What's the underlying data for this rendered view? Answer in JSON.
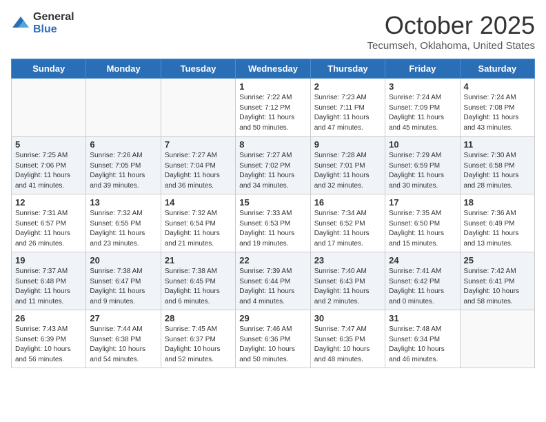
{
  "header": {
    "logo_general": "General",
    "logo_blue": "Blue",
    "month": "October 2025",
    "location": "Tecumseh, Oklahoma, United States"
  },
  "days_of_week": [
    "Sunday",
    "Monday",
    "Tuesday",
    "Wednesday",
    "Thursday",
    "Friday",
    "Saturday"
  ],
  "weeks": [
    [
      {
        "day": "",
        "info": ""
      },
      {
        "day": "",
        "info": ""
      },
      {
        "day": "",
        "info": ""
      },
      {
        "day": "1",
        "info": "Sunrise: 7:22 AM\nSunset: 7:12 PM\nDaylight: 11 hours\nand 50 minutes."
      },
      {
        "day": "2",
        "info": "Sunrise: 7:23 AM\nSunset: 7:11 PM\nDaylight: 11 hours\nand 47 minutes."
      },
      {
        "day": "3",
        "info": "Sunrise: 7:24 AM\nSunset: 7:09 PM\nDaylight: 11 hours\nand 45 minutes."
      },
      {
        "day": "4",
        "info": "Sunrise: 7:24 AM\nSunset: 7:08 PM\nDaylight: 11 hours\nand 43 minutes."
      }
    ],
    [
      {
        "day": "5",
        "info": "Sunrise: 7:25 AM\nSunset: 7:06 PM\nDaylight: 11 hours\nand 41 minutes."
      },
      {
        "day": "6",
        "info": "Sunrise: 7:26 AM\nSunset: 7:05 PM\nDaylight: 11 hours\nand 39 minutes."
      },
      {
        "day": "7",
        "info": "Sunrise: 7:27 AM\nSunset: 7:04 PM\nDaylight: 11 hours\nand 36 minutes."
      },
      {
        "day": "8",
        "info": "Sunrise: 7:27 AM\nSunset: 7:02 PM\nDaylight: 11 hours\nand 34 minutes."
      },
      {
        "day": "9",
        "info": "Sunrise: 7:28 AM\nSunset: 7:01 PM\nDaylight: 11 hours\nand 32 minutes."
      },
      {
        "day": "10",
        "info": "Sunrise: 7:29 AM\nSunset: 6:59 PM\nDaylight: 11 hours\nand 30 minutes."
      },
      {
        "day": "11",
        "info": "Sunrise: 7:30 AM\nSunset: 6:58 PM\nDaylight: 11 hours\nand 28 minutes."
      }
    ],
    [
      {
        "day": "12",
        "info": "Sunrise: 7:31 AM\nSunset: 6:57 PM\nDaylight: 11 hours\nand 26 minutes."
      },
      {
        "day": "13",
        "info": "Sunrise: 7:32 AM\nSunset: 6:55 PM\nDaylight: 11 hours\nand 23 minutes."
      },
      {
        "day": "14",
        "info": "Sunrise: 7:32 AM\nSunset: 6:54 PM\nDaylight: 11 hours\nand 21 minutes."
      },
      {
        "day": "15",
        "info": "Sunrise: 7:33 AM\nSunset: 6:53 PM\nDaylight: 11 hours\nand 19 minutes."
      },
      {
        "day": "16",
        "info": "Sunrise: 7:34 AM\nSunset: 6:52 PM\nDaylight: 11 hours\nand 17 minutes."
      },
      {
        "day": "17",
        "info": "Sunrise: 7:35 AM\nSunset: 6:50 PM\nDaylight: 11 hours\nand 15 minutes."
      },
      {
        "day": "18",
        "info": "Sunrise: 7:36 AM\nSunset: 6:49 PM\nDaylight: 11 hours\nand 13 minutes."
      }
    ],
    [
      {
        "day": "19",
        "info": "Sunrise: 7:37 AM\nSunset: 6:48 PM\nDaylight: 11 hours\nand 11 minutes."
      },
      {
        "day": "20",
        "info": "Sunrise: 7:38 AM\nSunset: 6:47 PM\nDaylight: 11 hours\nand 9 minutes."
      },
      {
        "day": "21",
        "info": "Sunrise: 7:38 AM\nSunset: 6:45 PM\nDaylight: 11 hours\nand 6 minutes."
      },
      {
        "day": "22",
        "info": "Sunrise: 7:39 AM\nSunset: 6:44 PM\nDaylight: 11 hours\nand 4 minutes."
      },
      {
        "day": "23",
        "info": "Sunrise: 7:40 AM\nSunset: 6:43 PM\nDaylight: 11 hours\nand 2 minutes."
      },
      {
        "day": "24",
        "info": "Sunrise: 7:41 AM\nSunset: 6:42 PM\nDaylight: 11 hours\nand 0 minutes."
      },
      {
        "day": "25",
        "info": "Sunrise: 7:42 AM\nSunset: 6:41 PM\nDaylight: 10 hours\nand 58 minutes."
      }
    ],
    [
      {
        "day": "26",
        "info": "Sunrise: 7:43 AM\nSunset: 6:39 PM\nDaylight: 10 hours\nand 56 minutes."
      },
      {
        "day": "27",
        "info": "Sunrise: 7:44 AM\nSunset: 6:38 PM\nDaylight: 10 hours\nand 54 minutes."
      },
      {
        "day": "28",
        "info": "Sunrise: 7:45 AM\nSunset: 6:37 PM\nDaylight: 10 hours\nand 52 minutes."
      },
      {
        "day": "29",
        "info": "Sunrise: 7:46 AM\nSunset: 6:36 PM\nDaylight: 10 hours\nand 50 minutes."
      },
      {
        "day": "30",
        "info": "Sunrise: 7:47 AM\nSunset: 6:35 PM\nDaylight: 10 hours\nand 48 minutes."
      },
      {
        "day": "31",
        "info": "Sunrise: 7:48 AM\nSunset: 6:34 PM\nDaylight: 10 hours\nand 46 minutes."
      },
      {
        "day": "",
        "info": ""
      }
    ]
  ]
}
